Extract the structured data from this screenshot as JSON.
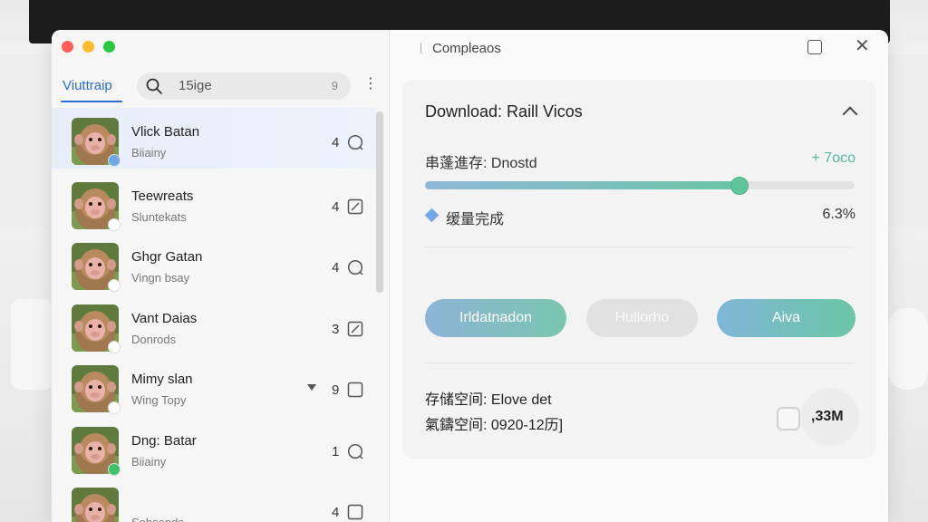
{
  "sidebar": {
    "title": "Viuttraip",
    "search_value": "15ige",
    "search_badge": "9",
    "items": [
      {
        "name": "Vlick Batan",
        "sub": "Biiainy",
        "count": "4",
        "icon": "chat-bubble-icon",
        "selected": true
      },
      {
        "name": "Teewreats",
        "sub": "Sluntekats",
        "count": "4",
        "icon": "edit-square-icon"
      },
      {
        "name": "Ghgr Gatan",
        "sub": "Vingn bsay",
        "count": "4",
        "icon": "chat-bubble-icon"
      },
      {
        "name": "Vant Daias",
        "sub": "Donrods",
        "count": "3",
        "icon": "edit-square-icon"
      },
      {
        "name": "Mimy slan",
        "sub": "Wing Topy",
        "count": "9",
        "icon": "square-icon"
      },
      {
        "name": "Dng: Batar",
        "sub": "Biiainy",
        "count": "1",
        "icon": "chat-bubble-icon"
      },
      {
        "name": "",
        "sub": "Sohsends",
        "count": "4",
        "icon": "square-icon"
      }
    ]
  },
  "main": {
    "title": "Compleaos",
    "download": {
      "title": "Download: Raill Vicos",
      "progress_label": "串蓬進存: Dnostd",
      "progress_value_text": "+ 7oco",
      "progress_fraction": 0.73,
      "status_label": "缓量完成",
      "status_value": "6.3%"
    },
    "buttons": [
      "Irldatnadon",
      "Hullorho",
      "Aiva"
    ],
    "storage_line1": "存储空间: Elove det",
    "storage_line2": "氣鑄空间:  0920-12历]",
    "size_text": ",33M"
  },
  "colors": {
    "accent": "#2a6bd6",
    "progress": "#5fc49b"
  }
}
